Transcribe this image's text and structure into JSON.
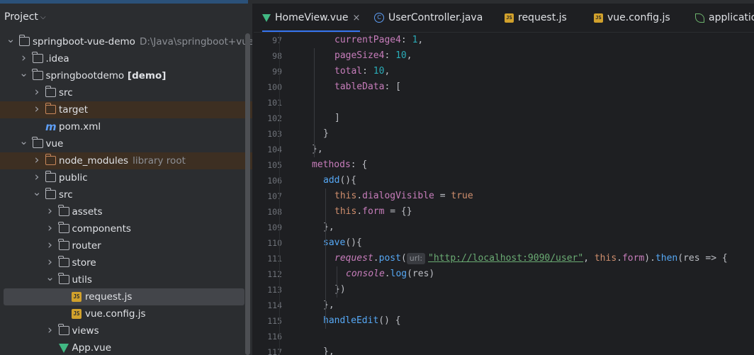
{
  "project": {
    "title": "Project",
    "tree": [
      {
        "label": "springboot-vue-demo",
        "hint": "D:\\Java\\springboot+vue框架",
        "bold": false,
        "indent": 0,
        "arrow": "down",
        "icon": "project-folder"
      },
      {
        "label": ".idea",
        "indent": 1,
        "arrow": "right",
        "icon": "folder"
      },
      {
        "label": "springbootdemo",
        "bold_suffix": "[demo]",
        "indent": 1,
        "arrow": "down",
        "icon": "module-folder"
      },
      {
        "label": "src",
        "indent": 2,
        "arrow": "right",
        "icon": "folder"
      },
      {
        "label": "target",
        "indent": 2,
        "arrow": "right",
        "icon": "folder-orange",
        "highlight": true
      },
      {
        "label": "pom.xml",
        "indent": 2,
        "arrow": "none",
        "icon": "maven"
      },
      {
        "label": "vue",
        "indent": 1,
        "arrow": "down",
        "icon": "folder"
      },
      {
        "label": "node_modules",
        "hint": "library root",
        "indent": 2,
        "arrow": "right",
        "icon": "folder-orange",
        "highlight": true
      },
      {
        "label": "public",
        "indent": 2,
        "arrow": "right",
        "icon": "folder"
      },
      {
        "label": "src",
        "indent": 2,
        "arrow": "down",
        "icon": "folder"
      },
      {
        "label": "assets",
        "indent": 3,
        "arrow": "right",
        "icon": "folder"
      },
      {
        "label": "components",
        "indent": 3,
        "arrow": "right",
        "icon": "folder"
      },
      {
        "label": "router",
        "indent": 3,
        "arrow": "right",
        "icon": "folder"
      },
      {
        "label": "store",
        "indent": 3,
        "arrow": "right",
        "icon": "folder"
      },
      {
        "label": "utils",
        "indent": 3,
        "arrow": "down",
        "icon": "folder"
      },
      {
        "label": "request.js",
        "indent": 4,
        "arrow": "none",
        "icon": "js",
        "selected": true
      },
      {
        "label": "vue.config.js",
        "indent": 4,
        "arrow": "none",
        "icon": "js"
      },
      {
        "label": "views",
        "indent": 3,
        "arrow": "right",
        "icon": "folder"
      },
      {
        "label": "App.vue",
        "indent": 3,
        "arrow": "none",
        "icon": "vue"
      }
    ]
  },
  "tabs": [
    {
      "label": "HomeView.vue",
      "icon": "vue",
      "active": true,
      "closable": true
    },
    {
      "label": "UserController.java",
      "icon": "class"
    },
    {
      "label": "request.js",
      "icon": "js"
    },
    {
      "label": "vue.config.js",
      "icon": "js"
    },
    {
      "label": "application",
      "icon": "spring"
    }
  ],
  "icons": {
    "js_text": "JS",
    "class_text": "C",
    "maven_text": "m",
    "close": "×",
    "chevron": "⌵"
  },
  "editor": {
    "lines": [
      {
        "n": "97",
        "indent": 2,
        "tokens": [
          [
            "prop",
            "currentPage4"
          ],
          [
            "def",
            ": "
          ],
          [
            "num",
            "1"
          ],
          [
            "def",
            ","
          ]
        ]
      },
      {
        "n": "98",
        "indent": 2,
        "tokens": [
          [
            "prop",
            "pageSize4"
          ],
          [
            "def",
            ": "
          ],
          [
            "num",
            "10"
          ],
          [
            "def",
            ","
          ]
        ]
      },
      {
        "n": "99",
        "indent": 2,
        "tokens": [
          [
            "prop",
            "total"
          ],
          [
            "def",
            ": "
          ],
          [
            "num",
            "10"
          ],
          [
            "def",
            ","
          ]
        ]
      },
      {
        "n": "100",
        "indent": 2,
        "tokens": [
          [
            "prop",
            "tableData"
          ],
          [
            "def",
            ": ["
          ]
        ]
      },
      {
        "n": "101",
        "indent": 2,
        "tokens": []
      },
      {
        "n": "102",
        "indent": 2,
        "tokens": [
          [
            "def",
            "]"
          ]
        ]
      },
      {
        "n": "103",
        "indent": 1,
        "tokens": [
          [
            "def",
            "}"
          ]
        ]
      },
      {
        "n": "104",
        "indent": 0,
        "tokens": [
          [
            "def",
            "},"
          ]
        ]
      },
      {
        "n": "105",
        "indent": 0,
        "tokens": [
          [
            "prop",
            "methods"
          ],
          [
            "def",
            ": {"
          ]
        ]
      },
      {
        "n": "106",
        "indent": 1,
        "tokens": [
          [
            "fn",
            "add"
          ],
          [
            "def",
            "(){"
          ]
        ]
      },
      {
        "n": "107",
        "indent": 2,
        "tokens": [
          [
            "kw",
            "this"
          ],
          [
            "def",
            "."
          ],
          [
            "prop",
            "dialogVisible"
          ],
          [
            "def",
            " = "
          ],
          [
            "kw",
            "true"
          ]
        ]
      },
      {
        "n": "108",
        "indent": 2,
        "tokens": [
          [
            "kw",
            "this"
          ],
          [
            "def",
            "."
          ],
          [
            "prop",
            "form"
          ],
          [
            "def",
            " = {}"
          ]
        ]
      },
      {
        "n": "109",
        "indent": 1,
        "tokens": [
          [
            "def",
            "},"
          ]
        ]
      },
      {
        "n": "110",
        "indent": 1,
        "tokens": [
          [
            "fn",
            "save"
          ],
          [
            "def",
            "(){"
          ]
        ]
      },
      {
        "n": "111",
        "indent": 2,
        "tokens": [
          [
            "ital",
            "request"
          ],
          [
            "def",
            "."
          ],
          [
            "fn",
            "post"
          ],
          [
            "def",
            "("
          ],
          [
            "hint",
            "url:"
          ],
          [
            "url",
            "\"http://localhost:9090/user\""
          ],
          [
            "def",
            ", "
          ],
          [
            "kw",
            "this"
          ],
          [
            "def",
            "."
          ],
          [
            "prop",
            "form"
          ],
          [
            "def",
            ")."
          ],
          [
            "fn",
            "then"
          ],
          [
            "def",
            "(res => {"
          ]
        ]
      },
      {
        "n": "112",
        "indent": 3,
        "tokens": [
          [
            "ital",
            "console"
          ],
          [
            "def",
            "."
          ],
          [
            "fn",
            "log"
          ],
          [
            "def",
            "(res)"
          ]
        ]
      },
      {
        "n": "113",
        "indent": 2,
        "tokens": [
          [
            "def",
            "})"
          ]
        ]
      },
      {
        "n": "114",
        "indent": 1,
        "tokens": [
          [
            "def",
            "},"
          ]
        ]
      },
      {
        "n": "115",
        "indent": 1,
        "tokens": [
          [
            "fn",
            "handleEdit"
          ],
          [
            "def",
            "() {"
          ]
        ]
      },
      {
        "n": "116",
        "indent": 1,
        "tokens": []
      },
      {
        "n": "117",
        "indent": 1,
        "tokens": [
          [
            "def",
            "},"
          ]
        ]
      }
    ]
  }
}
